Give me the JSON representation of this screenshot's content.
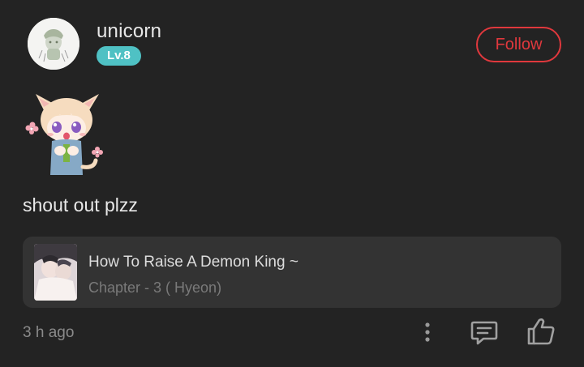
{
  "user": {
    "name": "unicorn",
    "level": "Lv.8"
  },
  "header": {
    "follow_label": "Follow"
  },
  "comment": {
    "text": "shout out plzz",
    "timestamp": "3 h ago"
  },
  "manga_card": {
    "title": "How To Raise A Demon King ~",
    "chapter": "Chapter - 3 ( Hyeon)"
  },
  "actions": {
    "more_icon": "more-vertical-icon",
    "reply_icon": "comment-reply-icon",
    "like_icon": "thumbs-up-icon"
  },
  "colors": {
    "background": "#232323",
    "accent_follow": "#e0383d",
    "level_badge": "#4fc1c4",
    "card_background": "#333333"
  }
}
